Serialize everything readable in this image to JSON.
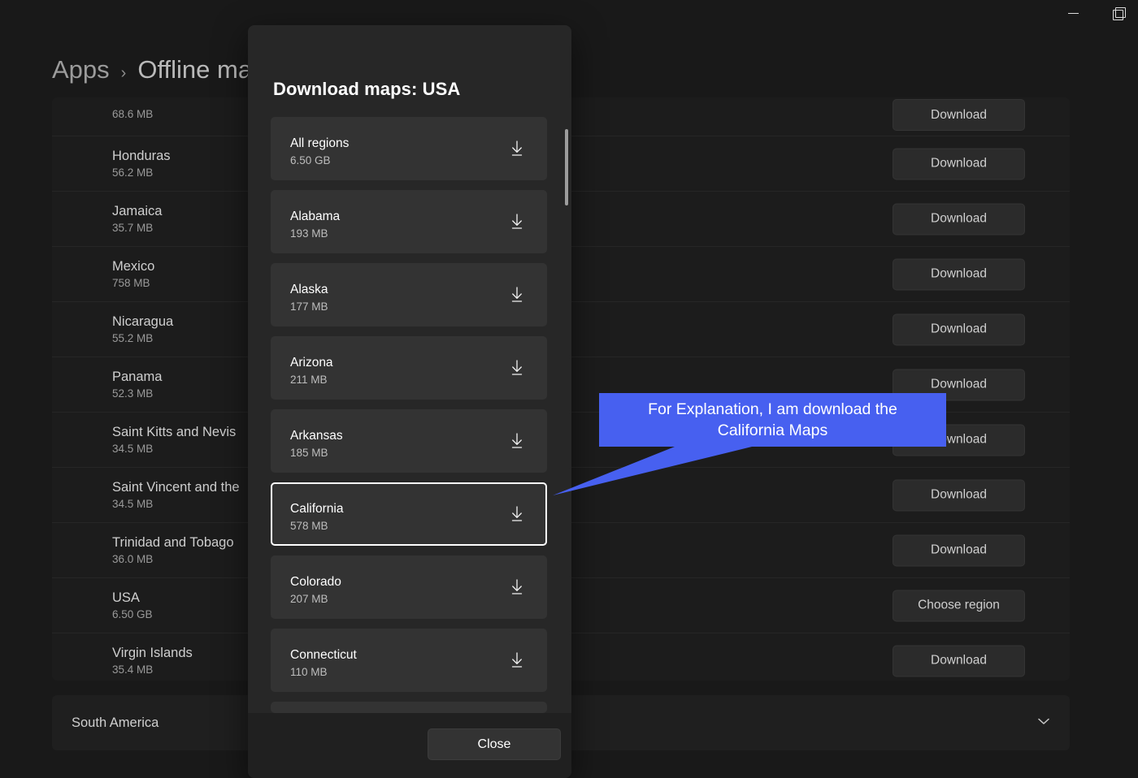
{
  "window": {
    "minimize_label": "Minimize",
    "restore_label": "Restore",
    "minimize_icon": "minimize-icon",
    "restore_icon": "restore-icon"
  },
  "breadcrumb": {
    "root": "Apps",
    "separator": "›",
    "current": "Offline maps"
  },
  "background_list": {
    "rows": [
      {
        "name": "",
        "size": "68.6 MB",
        "action": "Download",
        "clipped": true
      },
      {
        "name": "Honduras",
        "size": "56.2 MB",
        "action": "Download"
      },
      {
        "name": "Jamaica",
        "size": "35.7 MB",
        "action": "Download"
      },
      {
        "name": "Mexico",
        "size": "758 MB",
        "action": "Download"
      },
      {
        "name": "Nicaragua",
        "size": "55.2 MB",
        "action": "Download"
      },
      {
        "name": "Panama",
        "size": "52.3 MB",
        "action": "Download"
      },
      {
        "name": "Saint Kitts and Nevis",
        "size": "34.5 MB",
        "action": "Download"
      },
      {
        "name": "Saint Vincent and the",
        "size": "34.5 MB",
        "action": "Download"
      },
      {
        "name": "Trinidad and Tobago",
        "size": "36.0 MB",
        "action": "Download"
      },
      {
        "name": "USA",
        "size": "6.50 GB",
        "action": "Choose region"
      },
      {
        "name": "Virgin Islands",
        "size": "35.4 MB",
        "action": "Download"
      }
    ],
    "continent": {
      "label": "South America",
      "expand_icon": "chevron-down-icon"
    }
  },
  "dialog": {
    "title": "Download maps: USA",
    "close_label": "Close",
    "download_icon": "download-icon",
    "scrollbar": "vertical-scrollbar",
    "items": [
      {
        "name": "All regions",
        "size": "6.50 GB",
        "selected": false
      },
      {
        "name": "Alabama",
        "size": "193 MB",
        "selected": false
      },
      {
        "name": "Alaska",
        "size": "177 MB",
        "selected": false
      },
      {
        "name": "Arizona",
        "size": "211 MB",
        "selected": false
      },
      {
        "name": "Arkansas",
        "size": "185 MB",
        "selected": false
      },
      {
        "name": "California",
        "size": "578 MB",
        "selected": true
      },
      {
        "name": "Colorado",
        "size": "207 MB",
        "selected": false
      },
      {
        "name": "Connecticut",
        "size": "110 MB",
        "selected": false
      }
    ]
  },
  "callout": {
    "line1": "For Explanation, I am download the",
    "line2": "California Maps",
    "color": "#4760f0",
    "text_color": "#ffffff"
  }
}
